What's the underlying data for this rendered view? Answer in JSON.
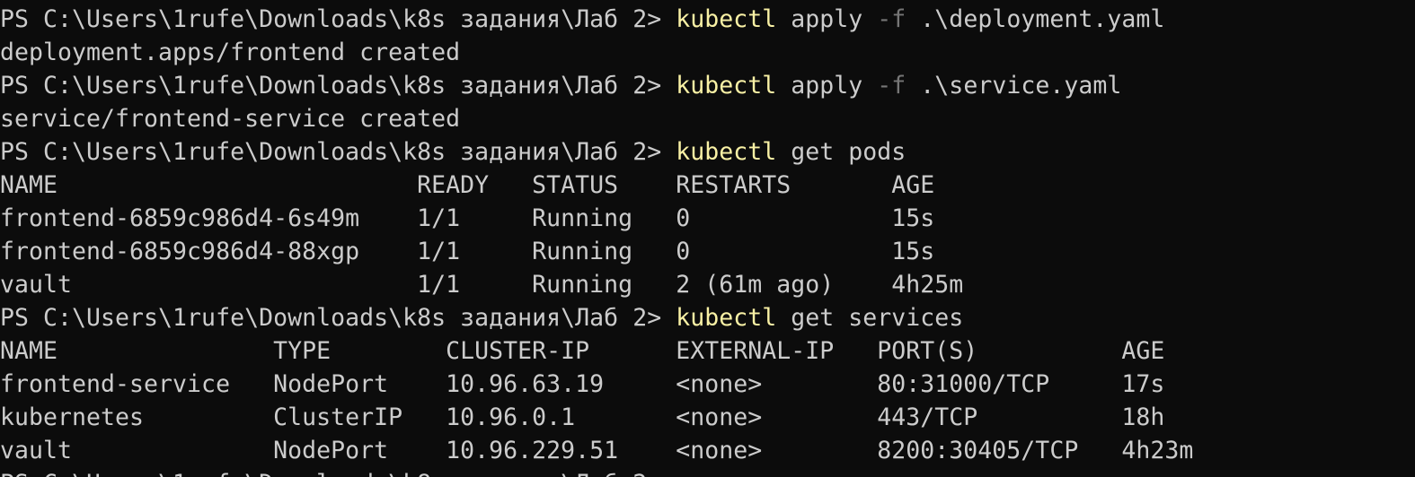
{
  "terminal": {
    "cursor_prompt": "PS C:\\Users\\1rufe\\Downloads\\k8s задания\\Лаб 2>",
    "lines": [
      {
        "type": "command",
        "prompt": "PS C:\\Users\\1rufe\\Downloads\\k8s задания\\Лаб 2> ",
        "cmd": "kubectl",
        "pre": " apply ",
        "param": "-f",
        "post": " .\\deployment.yaml"
      },
      {
        "type": "output",
        "text": "deployment.apps/frontend created"
      },
      {
        "type": "command",
        "prompt": "PS C:\\Users\\1rufe\\Downloads\\k8s задания\\Лаб 2> ",
        "cmd": "kubectl",
        "pre": " apply ",
        "param": "-f",
        "post": " .\\service.yaml"
      },
      {
        "type": "output",
        "text": "service/frontend-service created"
      },
      {
        "type": "command",
        "prompt": "PS C:\\Users\\1rufe\\Downloads\\k8s задания\\Лаб 2> ",
        "cmd": "kubectl",
        "pre": " get pods",
        "param": "",
        "post": ""
      },
      {
        "type": "output",
        "text": "NAME                         READY   STATUS    RESTARTS       AGE"
      },
      {
        "type": "output",
        "text": "frontend-6859c986d4-6s49m    1/1     Running   0              15s"
      },
      {
        "type": "output",
        "text": "frontend-6859c986d4-88xgp    1/1     Running   0              15s"
      },
      {
        "type": "output",
        "text": "vault                        1/1     Running   2 (61m ago)    4h25m"
      },
      {
        "type": "command",
        "prompt": "PS C:\\Users\\1rufe\\Downloads\\k8s задания\\Лаб 2> ",
        "cmd": "kubectl",
        "pre": " get services",
        "param": "",
        "post": ""
      },
      {
        "type": "output",
        "text": "NAME               TYPE        CLUSTER-IP      EXTERNAL-IP   PORT(S)          AGE"
      },
      {
        "type": "output",
        "text": "frontend-service   NodePort    10.96.63.19     <none>        80:31000/TCP     17s"
      },
      {
        "type": "output",
        "text": "kubernetes         ClusterIP   10.96.0.1       <none>        443/TCP          18h"
      },
      {
        "type": "output",
        "text": "vault              NodePort    10.96.229.51    <none>        8200:30405/TCP   4h23m"
      }
    ]
  }
}
